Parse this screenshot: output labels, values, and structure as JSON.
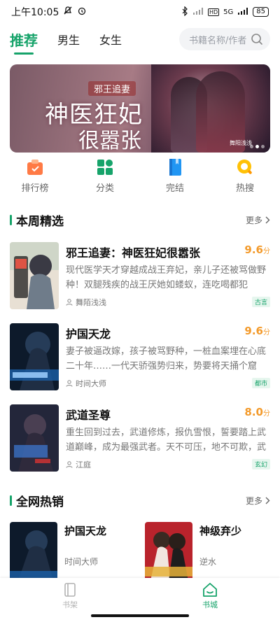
{
  "status": {
    "time": "上午10:05",
    "battery": "85",
    "network": "5G",
    "hd": "HD"
  },
  "nav": {
    "tabs": [
      {
        "label": "推荐"
      },
      {
        "label": "男生"
      },
      {
        "label": "女生"
      }
    ],
    "search_placeholder": "书籍名称/作者"
  },
  "banner": {
    "subtitle": "邪王追妻",
    "title_line1": "神医狂妃",
    "title_line2": "很嚣张",
    "author": "舞阳浅浅"
  },
  "categories": [
    {
      "label": "排行榜",
      "icon": "ranking-icon"
    },
    {
      "label": "分类",
      "icon": "category-grid-icon"
    },
    {
      "label": "完结",
      "icon": "book-complete-icon"
    },
    {
      "label": "热搜",
      "icon": "hot-search-icon"
    }
  ],
  "weekly": {
    "title": "本周精选",
    "more": "更多",
    "books": [
      {
        "name": "邪王追妻：神医狂妃很嚣张",
        "score": "9.6",
        "score_unit": "分",
        "desc": "现代医学天才穿越成战王弃妃，亲儿子还被骂做野种！双腿残疾的战王厌她如蝼蚁，连吃喝都犯愁！...",
        "author": "舞陌浅浅",
        "tag": "古言"
      },
      {
        "name": "护国天龙",
        "score": "9.6",
        "score_unit": "分",
        "desc": "妻子被逼改嫁，孩子被骂野种，一桩血案埋在心底二十年……一代天骄强势归来，势要将天捅个窟窿！",
        "author": "时间大师",
        "tag": "都市"
      },
      {
        "name": "武道圣尊",
        "score": "8.0",
        "score_unit": "分",
        "desc": "重生回到过去，武道修炼，报仇雪恨，誓要踏上武道巅峰，成为最强武者。天不可压，地不可欺，武道...",
        "author": "江庭",
        "tag": "玄幻"
      }
    ]
  },
  "hot": {
    "title": "全网热销",
    "more": "更多",
    "books": [
      {
        "name": "护国天龙",
        "author": "时间大师"
      },
      {
        "name": "神级弃少",
        "author": "逆水"
      }
    ]
  },
  "bottom_nav": [
    {
      "label": "书架"
    },
    {
      "label": "书城"
    }
  ],
  "colors": {
    "accent": "#16a36a",
    "score": "#f39a2b"
  }
}
